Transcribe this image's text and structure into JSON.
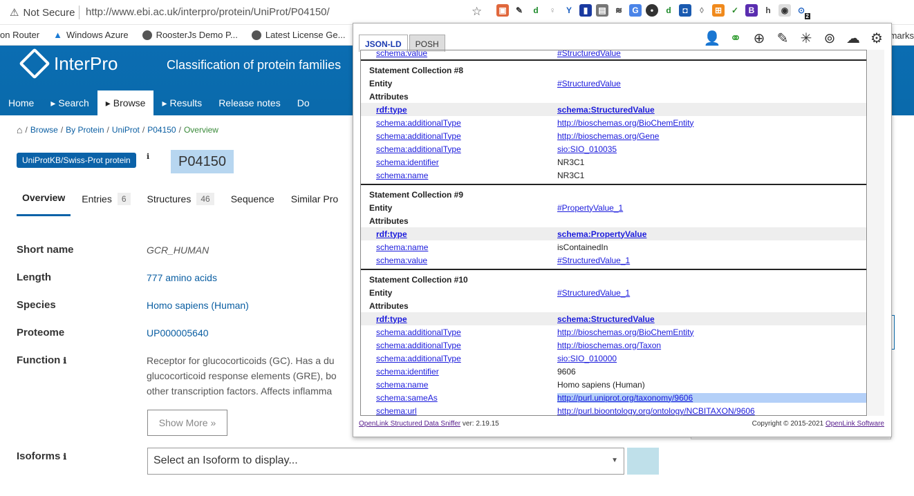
{
  "browser": {
    "security": "Not Secure",
    "url": "http://www.ebi.ac.uk/interpro/protein/UniProt/P04150/",
    "bookmarks": [
      "on Router",
      "Windows Azure",
      "RoosterJs Demo P...",
      "Latest License Ge..."
    ],
    "bookmarks_tail": "okmarks",
    "ext_badge": "2"
  },
  "header": {
    "logo": "InterPro",
    "tagline": "Classification of protein families",
    "nav": [
      "Home",
      "Search",
      "Browse",
      "Results",
      "Release notes",
      "Do"
    ]
  },
  "breadcrumb": [
    "Browse",
    "By Protein",
    "UniProt",
    "P04150",
    "Overview"
  ],
  "protein": {
    "badge": "UniProtKB/Swiss-Prot protein",
    "accession": "P04150",
    "tabs": [
      {
        "label": "Overview",
        "count": ""
      },
      {
        "label": "Entries",
        "count": "6"
      },
      {
        "label": "Structures",
        "count": "46"
      },
      {
        "label": "Sequence",
        "count": ""
      },
      {
        "label": "Similar Pro",
        "count": ""
      }
    ],
    "labels": {
      "short": "Short name",
      "length": "Length",
      "species": "Species",
      "proteome": "Proteome",
      "function": "Function",
      "isoforms": "Isoforms"
    },
    "short_name": "GCR_HUMAN",
    "length": "777 amino acids",
    "species": "Homo sapiens (Human)",
    "proteome": "UP000005640",
    "function_lines": [
      "Receptor for glucocorticoids (GC). Has a du",
      "glucocorticoid response elements (GRE), bo",
      "other transcription factors. Affects inflamma"
    ],
    "show_more": "Show More",
    "isoform_placeholder": "Select an Isoform to display..."
  },
  "popup": {
    "tabs": [
      "JSON-LD",
      "POSH"
    ],
    "top_row": {
      "k": "schema:value",
      "v": "#StructuredValue"
    },
    "collections": [
      {
        "title": "Statement Collection #8",
        "entity": "#StructuredValue",
        "rows": [
          {
            "k": "rdf:type",
            "v": "schema:StructuredValue",
            "hl": true
          },
          {
            "k": "schema:additionalType",
            "v": "http://bioschemas.org/BioChemEntity"
          },
          {
            "k": "schema:additionalType",
            "v": "http://bioschemas.org/Gene"
          },
          {
            "k": "schema:additionalType",
            "v": "sio:SIO_010035"
          },
          {
            "k": "schema:identifier",
            "v": "NR3C1",
            "plain": true
          },
          {
            "k": "schema:name",
            "v": "NR3C1",
            "plain": true
          }
        ]
      },
      {
        "title": "Statement Collection #9",
        "entity": "#PropertyValue_1",
        "rows": [
          {
            "k": "rdf:type",
            "v": "schema:PropertyValue",
            "hl": true
          },
          {
            "k": "schema:name",
            "v": "isContainedIn",
            "plain": true
          },
          {
            "k": "schema:value",
            "v": "#StructuredValue_1"
          }
        ]
      },
      {
        "title": "Statement Collection #10",
        "entity": "#StructuredValue_1",
        "rows": [
          {
            "k": "rdf:type",
            "v": "schema:StructuredValue",
            "hl": true
          },
          {
            "k": "schema:additionalType",
            "v": "http://bioschemas.org/BioChemEntity"
          },
          {
            "k": "schema:additionalType",
            "v": "http://bioschemas.org/Taxon"
          },
          {
            "k": "schema:additionalType",
            "v": "sio:SIO_010000"
          },
          {
            "k": "schema:identifier",
            "v": "9606",
            "plain": true
          },
          {
            "k": "schema:name",
            "v": "Homo sapiens (Human)",
            "plain": true
          },
          {
            "k": "schema:sameAs",
            "v": "http://purl.uniprot.org/taxonomy/9606",
            "selected": true
          },
          {
            "k": "schema:url",
            "v": "http://purl.bioontology.org/ontology/NCBITAXON/9606"
          }
        ]
      }
    ],
    "entity_label": "Entity",
    "attributes_label": "Attributes",
    "footer_link": "OpenLink Structured Data Sniffer",
    "footer_ver": " ver: 2.19.15",
    "copyright": "Copyright © 2015-2021 ",
    "copyright_link": "OpenLink Software"
  }
}
